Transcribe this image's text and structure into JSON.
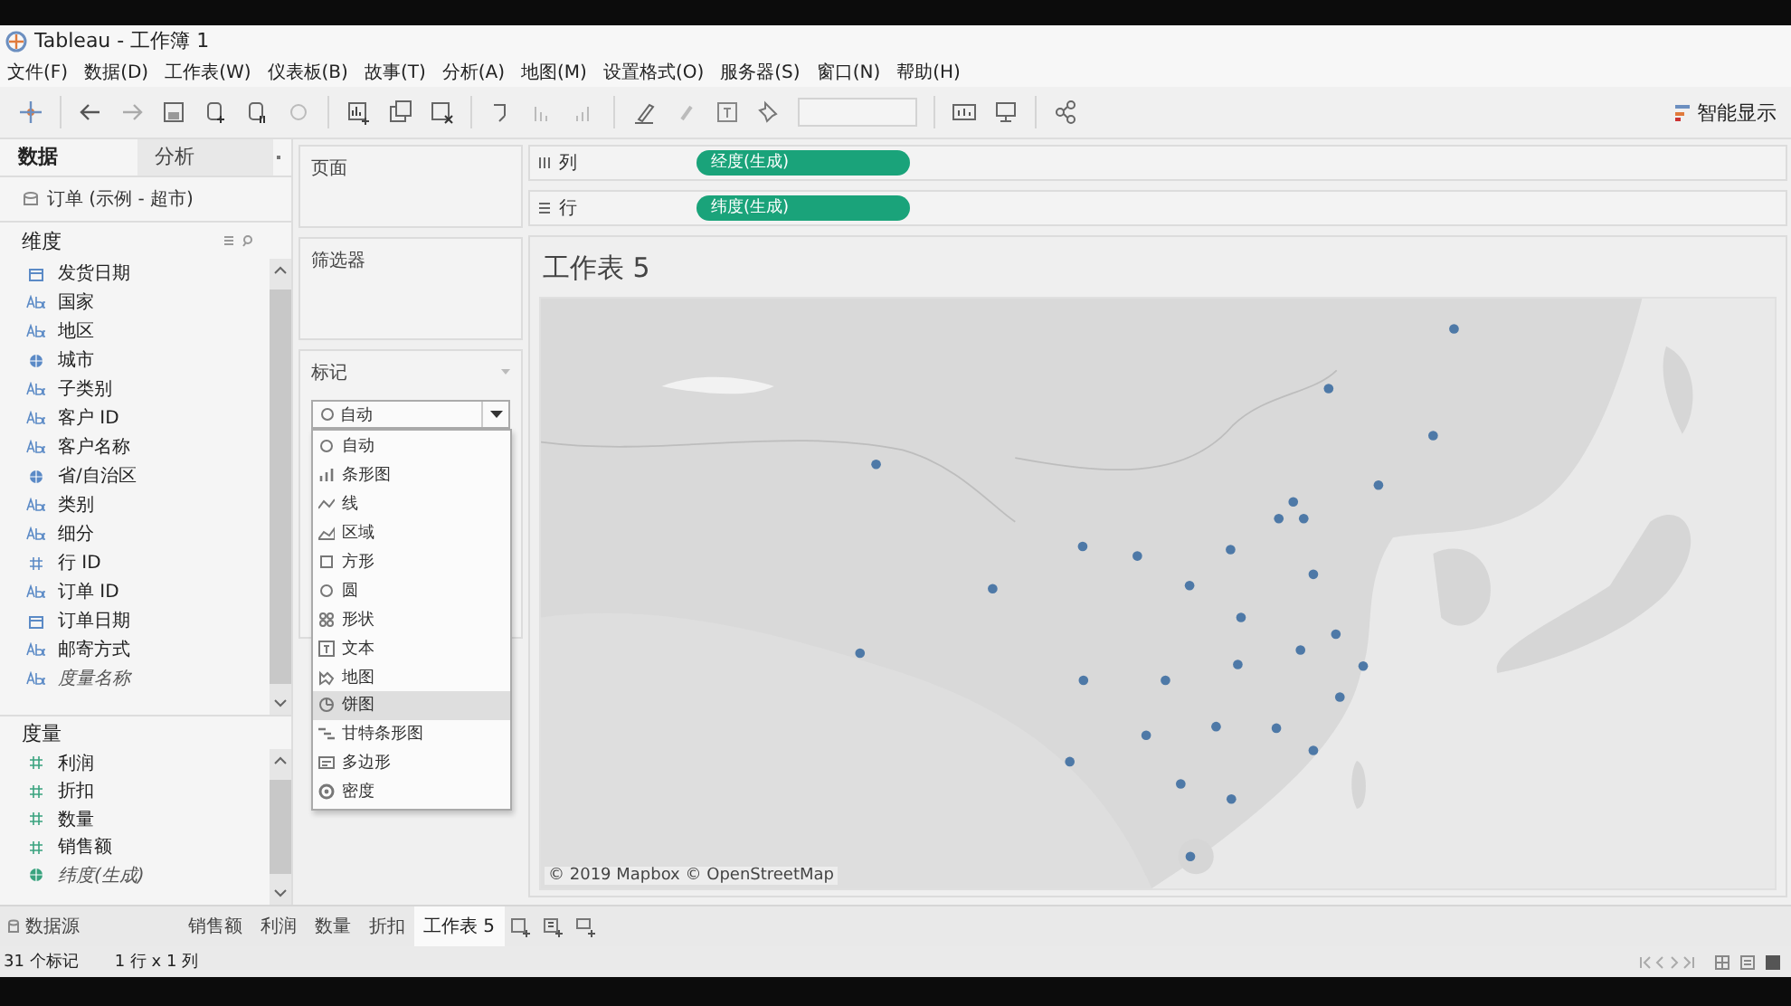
{
  "window": {
    "title": "Tableau - 工作簿 1"
  },
  "menu": [
    "文件(F)",
    "数据(D)",
    "工作表(W)",
    "仪表板(B)",
    "故事(T)",
    "分析(A)",
    "地图(M)",
    "设置格式(O)",
    "服务器(S)",
    "窗口(N)",
    "帮助(H)"
  ],
  "toolbar": {
    "show_me": "智能显示"
  },
  "side_tabs": [
    {
      "label": "数据",
      "selected": true
    },
    {
      "label": "分析",
      "selected": false
    }
  ],
  "data_source": "订单 (示例 - 超市)",
  "dimensions": {
    "title": "维度",
    "items": [
      {
        "label": "发货日期",
        "kind": "date",
        "italic": false
      },
      {
        "label": "国家",
        "kind": "string",
        "italic": false
      },
      {
        "label": "地区",
        "kind": "string",
        "italic": false
      },
      {
        "label": "城市",
        "kind": "geo",
        "italic": false
      },
      {
        "label": "子类别",
        "kind": "string",
        "italic": false
      },
      {
        "label": "客户 ID",
        "kind": "string",
        "italic": false
      },
      {
        "label": "客户名称",
        "kind": "string",
        "italic": false
      },
      {
        "label": "省/自治区",
        "kind": "geo",
        "italic": false
      },
      {
        "label": "类别",
        "kind": "string",
        "italic": false
      },
      {
        "label": "细分",
        "kind": "string",
        "italic": false
      },
      {
        "label": "行 ID",
        "kind": "number",
        "italic": false
      },
      {
        "label": "订单 ID",
        "kind": "string",
        "italic": false
      },
      {
        "label": "订单日期",
        "kind": "date",
        "italic": false
      },
      {
        "label": "邮寄方式",
        "kind": "string",
        "italic": false
      },
      {
        "label": "度量名称",
        "kind": "string",
        "italic": true
      }
    ]
  },
  "measures": {
    "title": "度量",
    "items": [
      {
        "label": "利润",
        "kind": "number",
        "italic": false
      },
      {
        "label": "折扣",
        "kind": "number",
        "italic": false
      },
      {
        "label": "数量",
        "kind": "number",
        "italic": false
      },
      {
        "label": "销售额",
        "kind": "number",
        "italic": false
      },
      {
        "label": "纬度(生成)",
        "kind": "geo",
        "italic": true
      }
    ]
  },
  "cards": {
    "pages": "页面",
    "filters": "筛选器",
    "marks": "标记"
  },
  "marks_type": {
    "value": "自动",
    "options": [
      {
        "label": "自动",
        "kind": "circle",
        "hovered": false
      },
      {
        "label": "条形图",
        "kind": "bar",
        "hovered": false
      },
      {
        "label": "线",
        "kind": "line",
        "hovered": false
      },
      {
        "label": "区域",
        "kind": "area",
        "hovered": false
      },
      {
        "label": "方形",
        "kind": "square",
        "hovered": false
      },
      {
        "label": "圆",
        "kind": "circle",
        "hovered": false
      },
      {
        "label": "形状",
        "kind": "shape",
        "hovered": false
      },
      {
        "label": "文本",
        "kind": "text",
        "hovered": false
      },
      {
        "label": "地图",
        "kind": "map",
        "hovered": false
      },
      {
        "label": "饼图",
        "kind": "pie",
        "hovered": true
      },
      {
        "label": "甘特条形图",
        "kind": "gantt",
        "hovered": false
      },
      {
        "label": "多边形",
        "kind": "polygon",
        "hovered": false
      },
      {
        "label": "密度",
        "kind": "density",
        "hovered": false
      }
    ]
  },
  "shelves": [
    {
      "label": "列",
      "kind": "columns",
      "pill": "经度(生成)"
    },
    {
      "label": "行",
      "kind": "rows",
      "pill": "纬度(生成)"
    }
  ],
  "sheet": {
    "title": "工作表 5",
    "attribution": "© 2019 Mapbox © OpenStreetMap"
  },
  "sheet_tabs": [
    {
      "label": "数据源",
      "kind": "source",
      "selected": false
    },
    {
      "label": "销售额",
      "kind": "sheet",
      "selected": false
    },
    {
      "label": "利润",
      "kind": "sheet",
      "selected": false
    },
    {
      "label": "数量",
      "kind": "sheet",
      "selected": false
    },
    {
      "label": "折扣",
      "kind": "sheet",
      "selected": false
    },
    {
      "label": "工作表 5",
      "kind": "sheet",
      "selected": true
    }
  ],
  "status_bar": {
    "marks": "31 个标记",
    "grid": "1 行 x 1 列"
  }
}
